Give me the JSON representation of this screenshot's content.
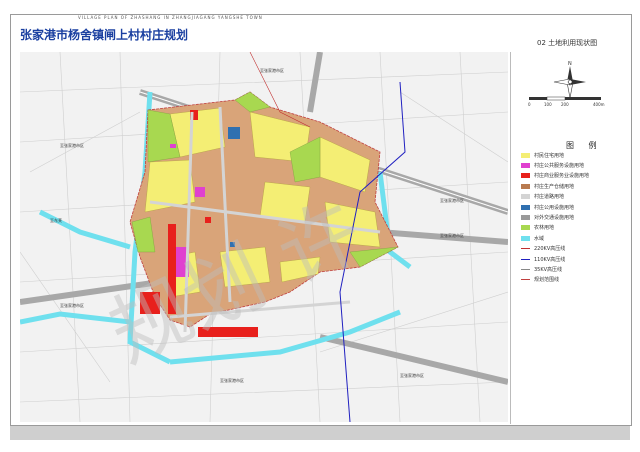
{
  "header": {
    "caption": "VILLAGE PLAN OF ZHASHANG  IN ZHANGJIAGANG YANGSHE TOWN",
    "title": "张家港市杨舍镇闸上村村庄规划",
    "sheet_name": "02 土地利用现状图"
  },
  "watermark": "规划 许",
  "compass": {
    "north_label": "N"
  },
  "scale_bar": {
    "labels": [
      "0",
      "100",
      "200",
      "400m"
    ]
  },
  "legend": {
    "title": "图 例",
    "items": [
      {
        "label": "村民住宅用地",
        "color": "#f4ee74",
        "type": "fill"
      },
      {
        "label": "村庄公共服务设施用地",
        "color": "#e040d0",
        "type": "fill"
      },
      {
        "label": "村庄商业服务业设施用地",
        "color": "#e8201c",
        "type": "fill"
      },
      {
        "label": "村庄生产仓储用地",
        "color": "#b87a4f",
        "type": "fill"
      },
      {
        "label": "村庄道路用地",
        "color": "#d4d4d4",
        "type": "fill"
      },
      {
        "label": "村庄公用设施用地",
        "color": "#3070b0",
        "type": "fill"
      },
      {
        "label": "对外交通设施用地",
        "color": "#9a9a9a",
        "type": "fill"
      },
      {
        "label": "农林用地",
        "color": "#a8d850",
        "type": "fill"
      },
      {
        "label": "水域",
        "color": "#6fe0ee",
        "type": "fill"
      },
      {
        "label": "220KV高压线",
        "color": "#c03030",
        "type": "line"
      },
      {
        "label": "110KV高压线",
        "color": "#2020c0",
        "type": "line"
      },
      {
        "label": "35KV高压线",
        "color": "#888888",
        "type": "line"
      },
      {
        "label": "规划范围线",
        "color": "#c04040",
        "type": "line"
      }
    ]
  },
  "map_labels": {
    "road_sw": "至张家港市区",
    "road_w": "至东莱",
    "road_nw": "至张家港市区",
    "road_e1": "至张家港市区",
    "road_e2": "至张家港市区",
    "road_s1": "至张家港市区",
    "road_s2": "至张家港市区",
    "road_n": "至张家港市区"
  }
}
